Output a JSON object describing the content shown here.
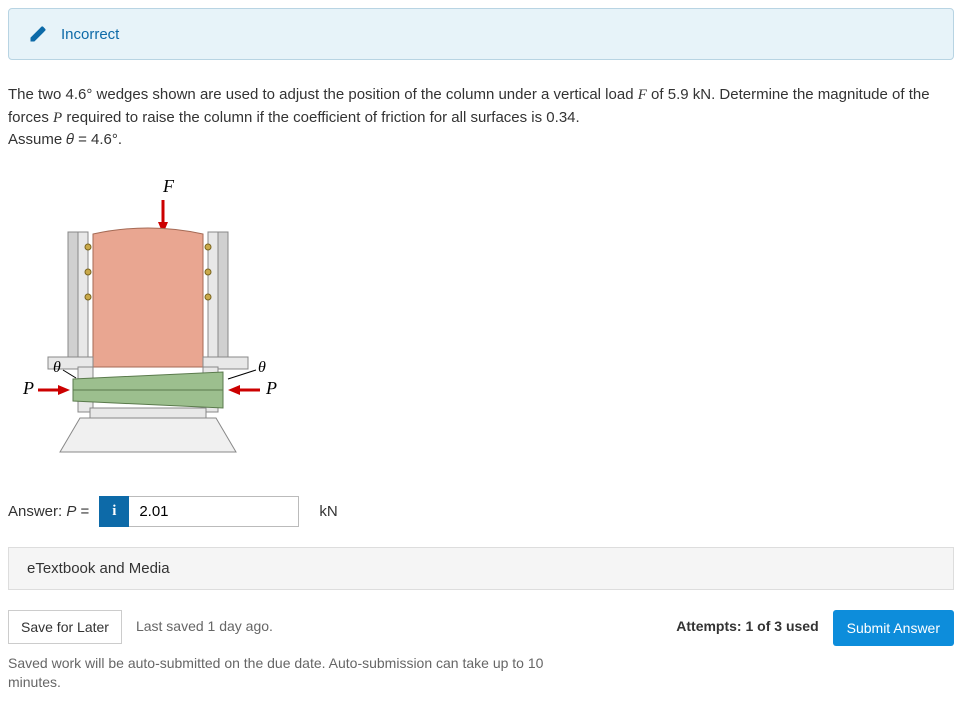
{
  "banner": {
    "status_label": "Incorrect"
  },
  "problem": {
    "text_part1": "The two 4.6° wedges shown are used to adjust the position of the column under a vertical load ",
    "F_var": "F",
    "text_part2": " of 5.9 kN. Determine the magnitude of the forces ",
    "P_var": "P",
    "text_part3": " required to raise the column if the coefficient of friction for all surfaces is 0.34.",
    "assume_text": "Assume 𝜃 =  4.6°."
  },
  "figure": {
    "label_F": "F",
    "label_P_left": "P",
    "label_P_right": "P",
    "label_theta_left": "θ",
    "label_theta_right": "θ"
  },
  "answer": {
    "prefix": "Answer: ",
    "var": "P",
    "equals": " =",
    "info_badge": "i",
    "value": "2.01",
    "unit": "kN"
  },
  "etextbook": {
    "label": "eTextbook and Media"
  },
  "footer": {
    "save_label": "Save for Later",
    "last_saved": "Last saved 1 day ago.",
    "attempts": "Attempts: 1 of 3 used",
    "submit_label": "Submit Answer",
    "auto_note": "Saved work will be auto-submitted on the due date. Auto-submission can take up to 10 minutes."
  }
}
